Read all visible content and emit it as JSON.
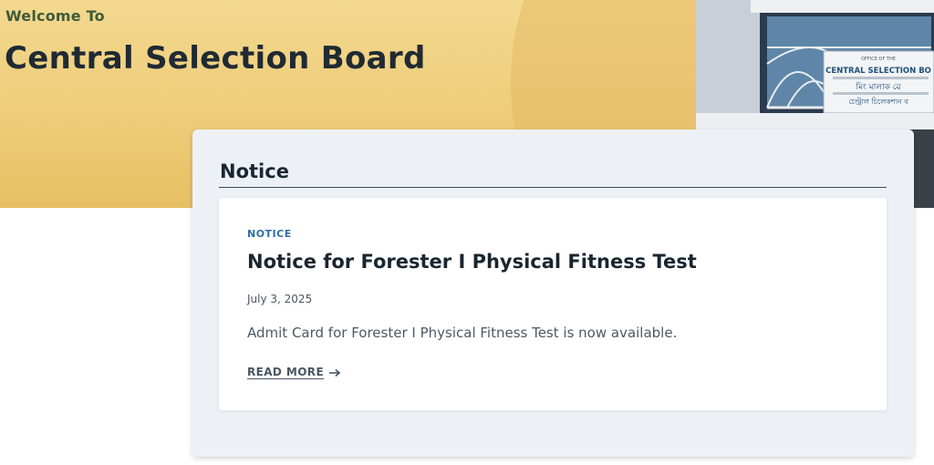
{
  "hero": {
    "welcome": "Welcome To",
    "title": "Central Selection Board",
    "sign_text": "CENTRAL SELECTION BO",
    "sign_header": "OFFICE OF THE",
    "sign_local_script": "মিং মালাক ৱে",
    "sign_local_script_2": "চেন্ট্রাল চিলেকশ্যন ব",
    "photo_icon": "office-building-photo"
  },
  "notice_section": {
    "heading": "Notice",
    "posts": [
      {
        "category": "NOTICE",
        "title": "Notice for Forester I Physical Fitness Test",
        "date": "July 3, 2025",
        "excerpt": "Admit Card for Forester I Physical Fitness Test is now available.",
        "read_more": "READ MORE",
        "read_more_icon": "arrow-right-icon"
      }
    ]
  },
  "colors": {
    "banner": "#f0cf80",
    "accent_link": "#2f6ea5",
    "panel_bg": "#edf1f5"
  }
}
